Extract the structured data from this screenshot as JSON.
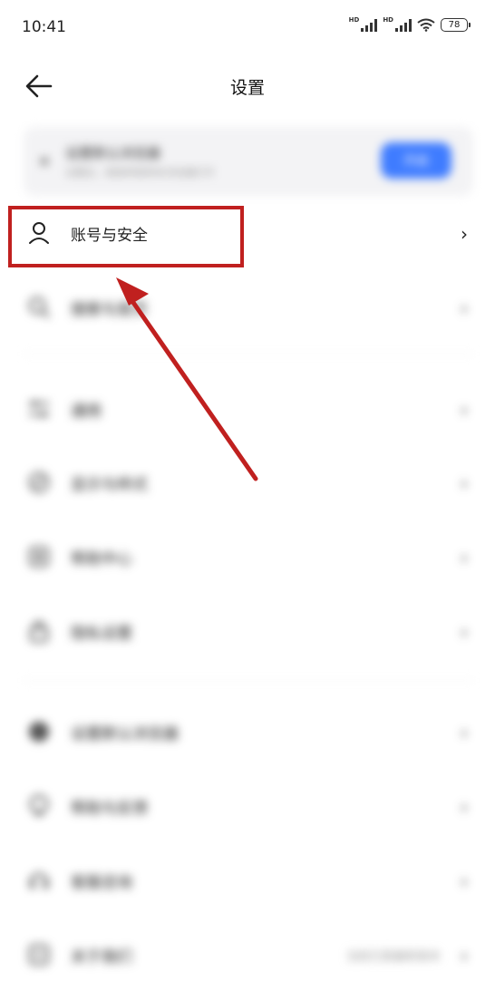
{
  "status_bar": {
    "time": "10:41",
    "hd1": "HD",
    "hd2": "HD",
    "battery": "78"
  },
  "header": {
    "title": "设置"
  },
  "banner": {
    "title": "设置默认浏览器",
    "subtitle": "设置后，链接将使用本浏览器打开",
    "button": "开启"
  },
  "rows": [
    {
      "label": "账号与安全",
      "icon": "person-icon"
    },
    {
      "label": "搜索与首页",
      "icon": "search-icon"
    },
    {
      "label": "通用",
      "icon": "sliders-icon"
    },
    {
      "label": "显示与样式",
      "icon": "palette-icon"
    },
    {
      "label": "帮助中心",
      "icon": "help-icon"
    },
    {
      "label": "隐私设置",
      "icon": "lock-icon"
    },
    {
      "label": "设置默认浏览器",
      "icon": "globe-icon"
    },
    {
      "label": "帮助与反馈",
      "icon": "feedback-icon"
    },
    {
      "label": "客服咨询",
      "icon": "headset-icon"
    },
    {
      "label": "关于我们",
      "icon": "info-icon",
      "value": "当前已是最新版本"
    }
  ],
  "colors": {
    "highlight": "#c0201f",
    "accent": "#3f7cff"
  }
}
